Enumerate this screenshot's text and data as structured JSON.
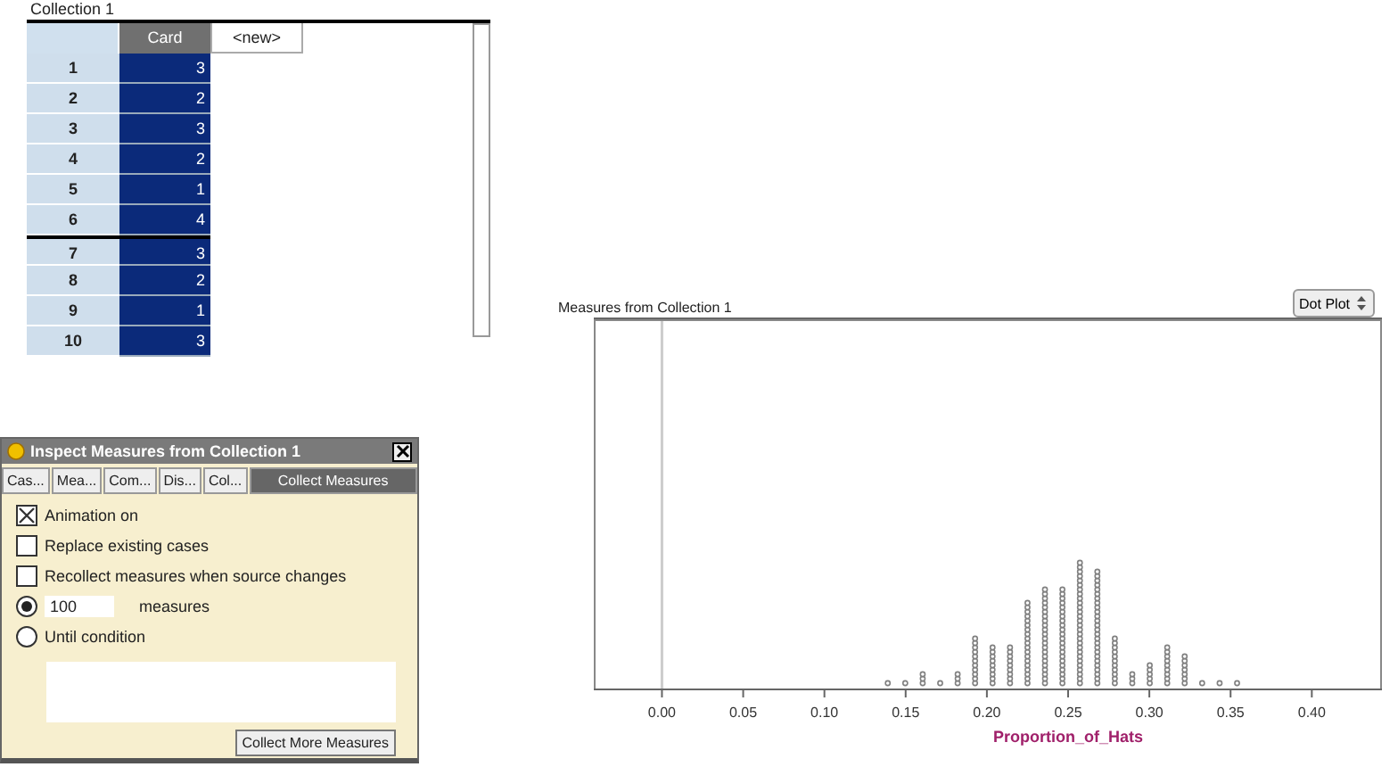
{
  "collection": {
    "title": "Collection 1",
    "columns": [
      {
        "label": "Card",
        "selected": true
      },
      {
        "label": "<new>",
        "selected": false
      }
    ],
    "rows": [
      {
        "index": "1",
        "card": "3",
        "selected": false
      },
      {
        "index": "2",
        "card": "2",
        "selected": false
      },
      {
        "index": "3",
        "card": "3",
        "selected": false
      },
      {
        "index": "4",
        "card": "2",
        "selected": false
      },
      {
        "index": "5",
        "card": "1",
        "selected": false
      },
      {
        "index": "6",
        "card": "4",
        "selected": false
      },
      {
        "index": "7",
        "card": "3",
        "selected": true
      },
      {
        "index": "8",
        "card": "2",
        "selected": false
      },
      {
        "index": "9",
        "card": "1",
        "selected": false
      },
      {
        "index": "10",
        "card": "3",
        "selected": false
      }
    ]
  },
  "inspector": {
    "title": "Inspect Measures from Collection 1",
    "tabs": [
      {
        "label": "Cas...",
        "selected": false
      },
      {
        "label": "Mea...",
        "selected": false
      },
      {
        "label": "Com...",
        "selected": false
      },
      {
        "label": "Dis...",
        "selected": false
      },
      {
        "label": "Col...",
        "selected": false
      },
      {
        "label": "Collect Measures",
        "selected": true
      }
    ],
    "options": [
      {
        "kind": "checkbox",
        "label": "Animation on",
        "checked": true
      },
      {
        "kind": "checkbox",
        "label": "Replace existing cases",
        "checked": false
      },
      {
        "kind": "checkbox",
        "label": "Recollect measures when source changes",
        "checked": false
      },
      {
        "kind": "radio",
        "count_field": "100",
        "suffix": "measures",
        "checked": true
      },
      {
        "kind": "radio",
        "label": "Until condition",
        "checked": false
      }
    ],
    "button": "Collect More Measures"
  },
  "graph": {
    "title": "Measures from Collection 1",
    "plot_type": "Dot Plot",
    "axis_label": "Proportion_of_Hats",
    "tick_labels": [
      "0.00",
      "0.05",
      "0.10",
      "0.15",
      "0.20",
      "0.25",
      "0.30",
      "0.35",
      "0.40"
    ]
  }
}
